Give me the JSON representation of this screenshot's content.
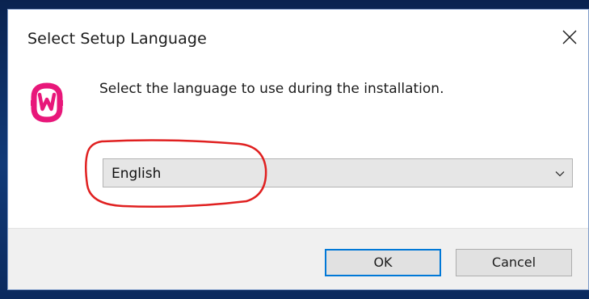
{
  "dialog": {
    "title": "Select Setup Language",
    "message": "Select the language to use during the installation.",
    "close_icon": "close-icon",
    "logo_icon": "wampserver-logo"
  },
  "language_select": {
    "selected_value": "English",
    "dropdown_icon": "chevron-down-icon"
  },
  "buttons": {
    "ok_label": "OK",
    "cancel_label": "Cancel"
  },
  "colors": {
    "logo": "#e8177a",
    "annotation": "#e02020",
    "focus_border": "#0078d7"
  }
}
